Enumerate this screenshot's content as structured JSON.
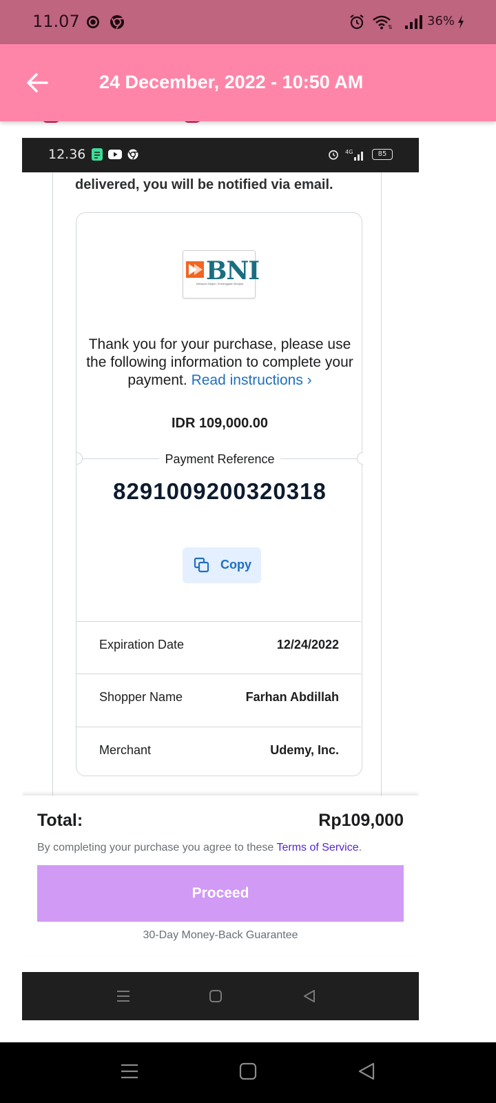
{
  "status_bar": {
    "time": "11.07",
    "battery": "36%",
    "icons": [
      "target-icon",
      "chrome-icon",
      "alarm-icon",
      "wifi-icon",
      "signal-icon",
      "charging-icon"
    ]
  },
  "app_bar": {
    "title": "24 December, 2022 - 10:50 AM",
    "back_icon": "arrow-left-icon",
    "bg": "#ff85a8"
  },
  "inner": {
    "status": {
      "time": "12.36",
      "battery": "85"
    },
    "delivered_text": "delivered, you will be notified via email.",
    "payment": {
      "bank_logo": {
        "name": "BNI",
        "tagline": "Melayani Negeri, Kebanggaan Bangsa"
      },
      "thanks_text": "Thank you for your purchase, please use the following information to complete your payment.",
      "read_link": "Read instructions ›",
      "amount": "IDR 109,000.00",
      "reference_label": "Payment Reference",
      "reference_number": "8291009200320318",
      "copy_label": "Copy",
      "details": [
        {
          "label": "Expiration Date",
          "value": "12/24/2022"
        },
        {
          "label": "Shopper Name",
          "value": "Farhan Abdillah"
        },
        {
          "label": "Merchant",
          "value": "Udemy, Inc."
        }
      ]
    },
    "checkout": {
      "total_label": "Total:",
      "total_value": "Rp109,000",
      "terms_prefix": "By completing your purchase you agree to these",
      "terms_link": "Terms of Service",
      "terms_suffix": ".",
      "proceed_label": "Proceed",
      "guarantee": "30-Day Money-Back Guarantee"
    }
  },
  "colors": {
    "accent_pink": "#ff85a8",
    "status_bar": "#bf6580",
    "link_blue": "#1f6fc0",
    "proceed_purple": "#d19af5",
    "terms_purple": "#5624d0"
  }
}
